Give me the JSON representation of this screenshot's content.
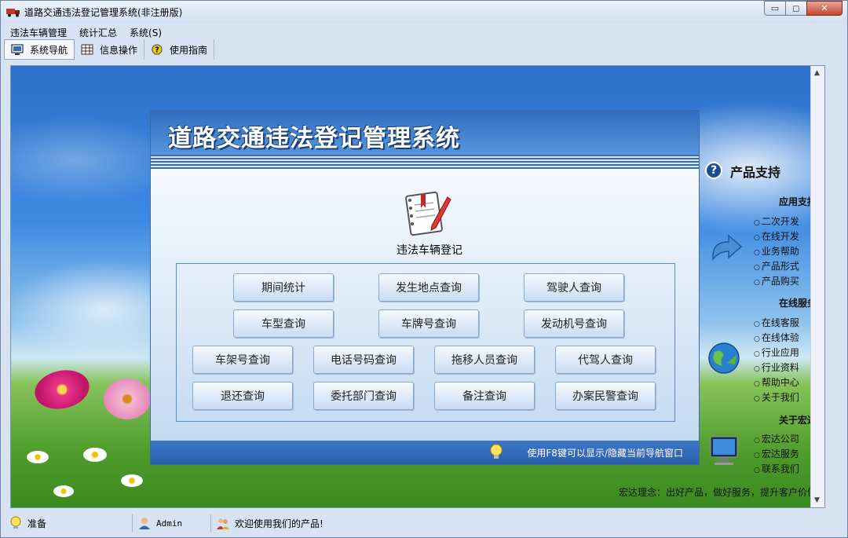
{
  "window": {
    "title": "道路交通违法登记管理系统(非注册版)",
    "controls": {
      "minimize": "▭",
      "maximize": "◻",
      "close": "✕"
    }
  },
  "menubar": [
    "违法车辆管理",
    "统计汇总",
    "系统(S)"
  ],
  "toolbar": [
    {
      "label": "系统导航",
      "icon": "monitor-icon",
      "active": true
    },
    {
      "label": "信息操作",
      "icon": "grid-icon",
      "active": false
    },
    {
      "label": "使用指南",
      "icon": "help-icon",
      "active": false
    }
  ],
  "panel": {
    "title": "道路交通违法登记管理系统",
    "register_label": "违法车辆登记",
    "register_icon": "notebook-pen-icon",
    "buttons": [
      "期间统计",
      "发生地点查询",
      "驾驶人查询",
      "车型查询",
      "车牌号查询",
      "发动机号查询",
      "车架号查询",
      "电话号码查询",
      "拖移人员查询",
      "代驾人查询",
      "退还查询",
      "委托部门查询",
      "备注查询",
      "办案民警查询"
    ],
    "footer_text": "使用F8键可以显示/隐藏当前导航窗口"
  },
  "side": {
    "title": "产品支持",
    "sections": [
      {
        "head": "应用支持",
        "items": [
          "二次开发",
          "在线开发",
          "业务帮助",
          "产品形式",
          "产品购买"
        ]
      },
      {
        "head": "在线服务",
        "items": [
          "在线客服",
          "在线体验",
          "行业应用",
          "行业资料",
          "帮助中心",
          "关于我们"
        ]
      },
      {
        "head": "关于宏达",
        "items": [
          "宏达公司",
          "宏达服务",
          "联系我们"
        ]
      }
    ],
    "motto": "宏达理念：出好产品，做好服务，提升客户价值！"
  },
  "statusbar": [
    {
      "text": "准备",
      "icon": "bulb-icon"
    },
    {
      "text": "Admin",
      "icon": "user-icon"
    },
    {
      "text": "欢迎使用我们的产品!",
      "icon": "people-icon"
    }
  ],
  "colors": {
    "panel_header": "#2f6cc0",
    "panel_footer": "#2a5ea8",
    "sky": "#3d8ae2",
    "grass": "#4e9b2c"
  }
}
